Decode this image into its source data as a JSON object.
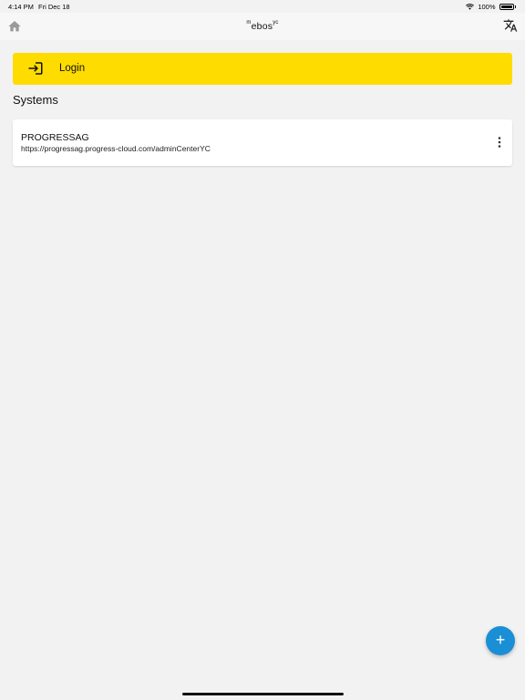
{
  "status_bar": {
    "time": "4:14 PM",
    "date": "Fri Dec 18",
    "battery": "100%"
  },
  "app_bar": {
    "title_prefix": "m",
    "title_main": "ebos",
    "title_suffix": "yc",
    "home_icon": "home-icon",
    "translate_icon": "translate-icon"
  },
  "login": {
    "label": "Login",
    "icon": "login-icon"
  },
  "systems": {
    "title": "Systems",
    "items": [
      {
        "name": "PROGRESSAG",
        "url": "https://progressag.progress-cloud.com/adminCenterYC"
      }
    ]
  },
  "fab": {
    "label": "+"
  },
  "colors": {
    "accent": "#ffdc00",
    "fab": "#1a8fd6",
    "background": "#f2f2f2"
  }
}
